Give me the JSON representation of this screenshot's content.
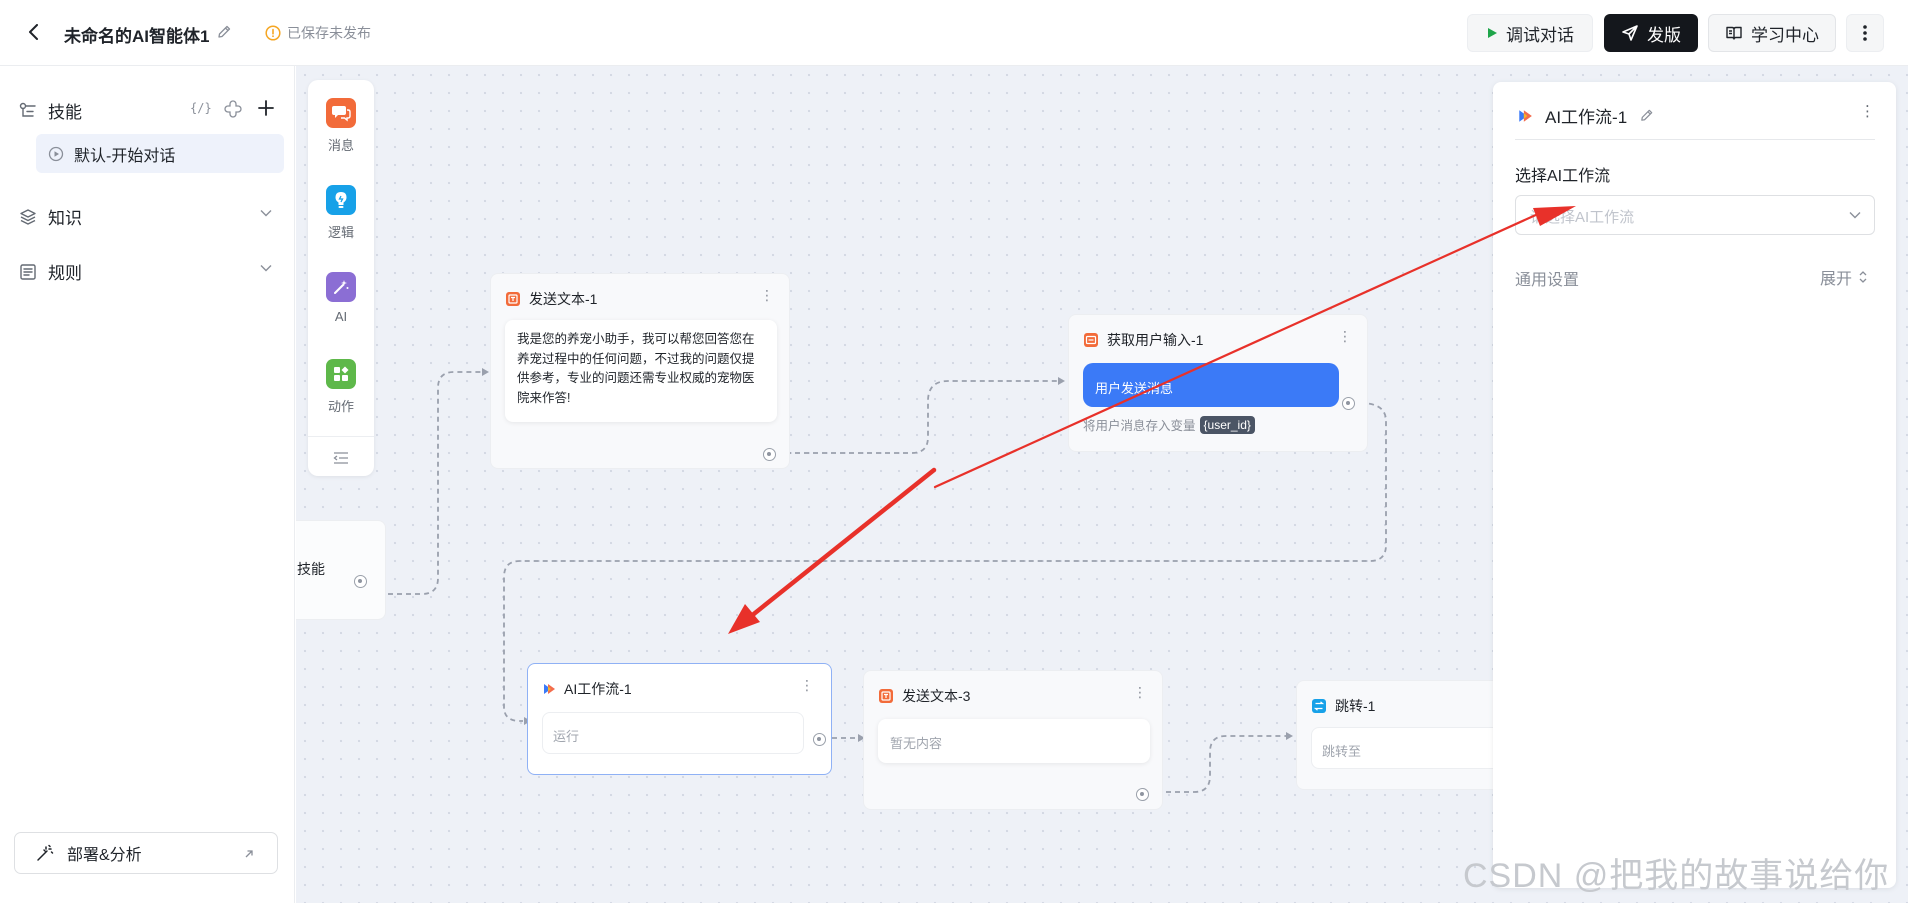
{
  "header": {
    "title": "未命名的AI智能体1",
    "save_status": "已保存未发布",
    "buttons": {
      "debug": "调试对话",
      "publish": "发版",
      "learn": "学习中心"
    }
  },
  "sidebar": {
    "skills_label": "技能",
    "skills_code_icon": "{/}",
    "skill_item": "默认-开始对话",
    "knowledge_label": "知识",
    "rules_label": "规则",
    "deploy_label": "部署&分析"
  },
  "toolbox": {
    "items": [
      {
        "label": "消息",
        "icon": "message-icon",
        "color": "#f26b3a"
      },
      {
        "label": "逻辑",
        "icon": "logic-icon",
        "color": "#17a1e8"
      },
      {
        "label": "AI",
        "icon": "magic-wand-icon",
        "color": "#8b6ed4"
      },
      {
        "label": "动作",
        "icon": "action-icon",
        "color": "#5eb84a"
      }
    ]
  },
  "nodes": {
    "start_partial": "技能",
    "send_text_1": {
      "title": "发送文本-1",
      "content": "我是您的养宠小助手，我可以帮您回答您在养宠过程中的任何问题，不过我的问题仅提供参考，专业的问题还需专业权威的宠物医院来作答!"
    },
    "get_user_input": {
      "title": "获取用户输入-1",
      "bubble": "用户发送消息",
      "caption": "将用户消息存入变量",
      "variable": "{user_id}"
    },
    "ai_workflow": {
      "title": "AI工作流-1",
      "field": "运行"
    },
    "send_text_3": {
      "title": "发送文本-3",
      "content": "暂无内容"
    },
    "jump": {
      "title": "跳转-1",
      "field": "跳转至"
    }
  },
  "panel": {
    "title": "AI工作流-1",
    "select_label": "选择AI工作流",
    "select_placeholder": "请选择AI工作流",
    "general_settings": "通用设置",
    "expand": "展开"
  },
  "colors": {
    "accent_blue": "#3b7af7",
    "annotation_red": "#e8312a",
    "publish_bg": "#14171c"
  },
  "watermark": "CSDN @把我的故事说给你"
}
